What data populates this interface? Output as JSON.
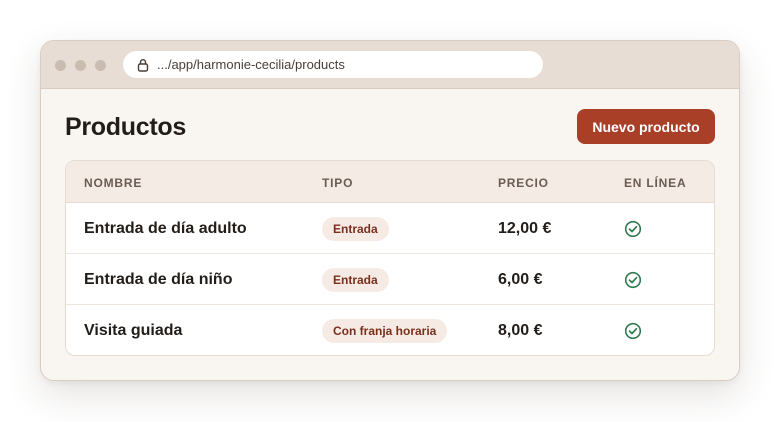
{
  "browser": {
    "url": ".../app/harmonie-cecilia/products",
    "icons": {
      "lock": "lock-icon"
    }
  },
  "page": {
    "title": "Productos",
    "new_button_label": "Nuevo producto"
  },
  "table": {
    "columns": [
      "NOMBRE",
      "TIPO",
      "PRECIO",
      "EN LÍNEA"
    ],
    "rows": [
      {
        "name": "Entrada de día adulto",
        "type": "Entrada",
        "price": "12,00 €",
        "online": true
      },
      {
        "name": "Entrada de día niño",
        "type": "Entrada",
        "price": "6,00 €",
        "online": true
      },
      {
        "name": "Visita guiada",
        "type": "Con franja horaria",
        "price": "8,00 €",
        "online": true
      }
    ]
  },
  "colors": {
    "accent": "#a83f26",
    "badge_bg": "#f6ebe4",
    "badge_text": "#7a2e1c",
    "check": "#2f7a4f",
    "titlebar": "#e7ddd4",
    "page_bg": "#f9f6f2"
  }
}
